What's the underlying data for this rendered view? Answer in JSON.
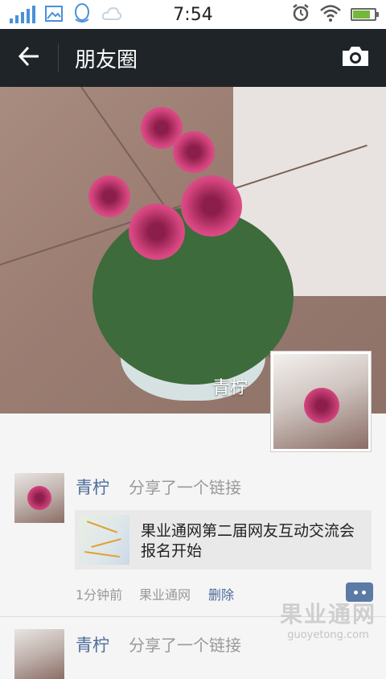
{
  "status_bar": {
    "time": "7:54",
    "icons": [
      "signal-icon",
      "image-icon",
      "qq-icon",
      "cloud-icon",
      "alarm-icon",
      "wifi-icon",
      "battery-icon"
    ],
    "battery_level": 0.8
  },
  "header": {
    "title": "朋友圈",
    "back_icon": "back-arrow-icon",
    "camera_icon": "camera-icon"
  },
  "cover": {
    "user_name": "青柠"
  },
  "posts": [
    {
      "author": "青柠",
      "action": "分享了一个链接",
      "link_title": "果业通网第二届网友互动交流会报名开始",
      "time": "1分钟前",
      "source": "果业通网",
      "delete_label": "删除"
    },
    {
      "author": "青柠",
      "action": "分享了一个链接"
    }
  ],
  "watermark": {
    "text": "果业通网",
    "url": "guoyetong.com"
  },
  "colors": {
    "titlebar": "#1f2428",
    "name_link": "#4b6b9a",
    "muted": "#999999",
    "status_icon": "#4a90d9"
  }
}
